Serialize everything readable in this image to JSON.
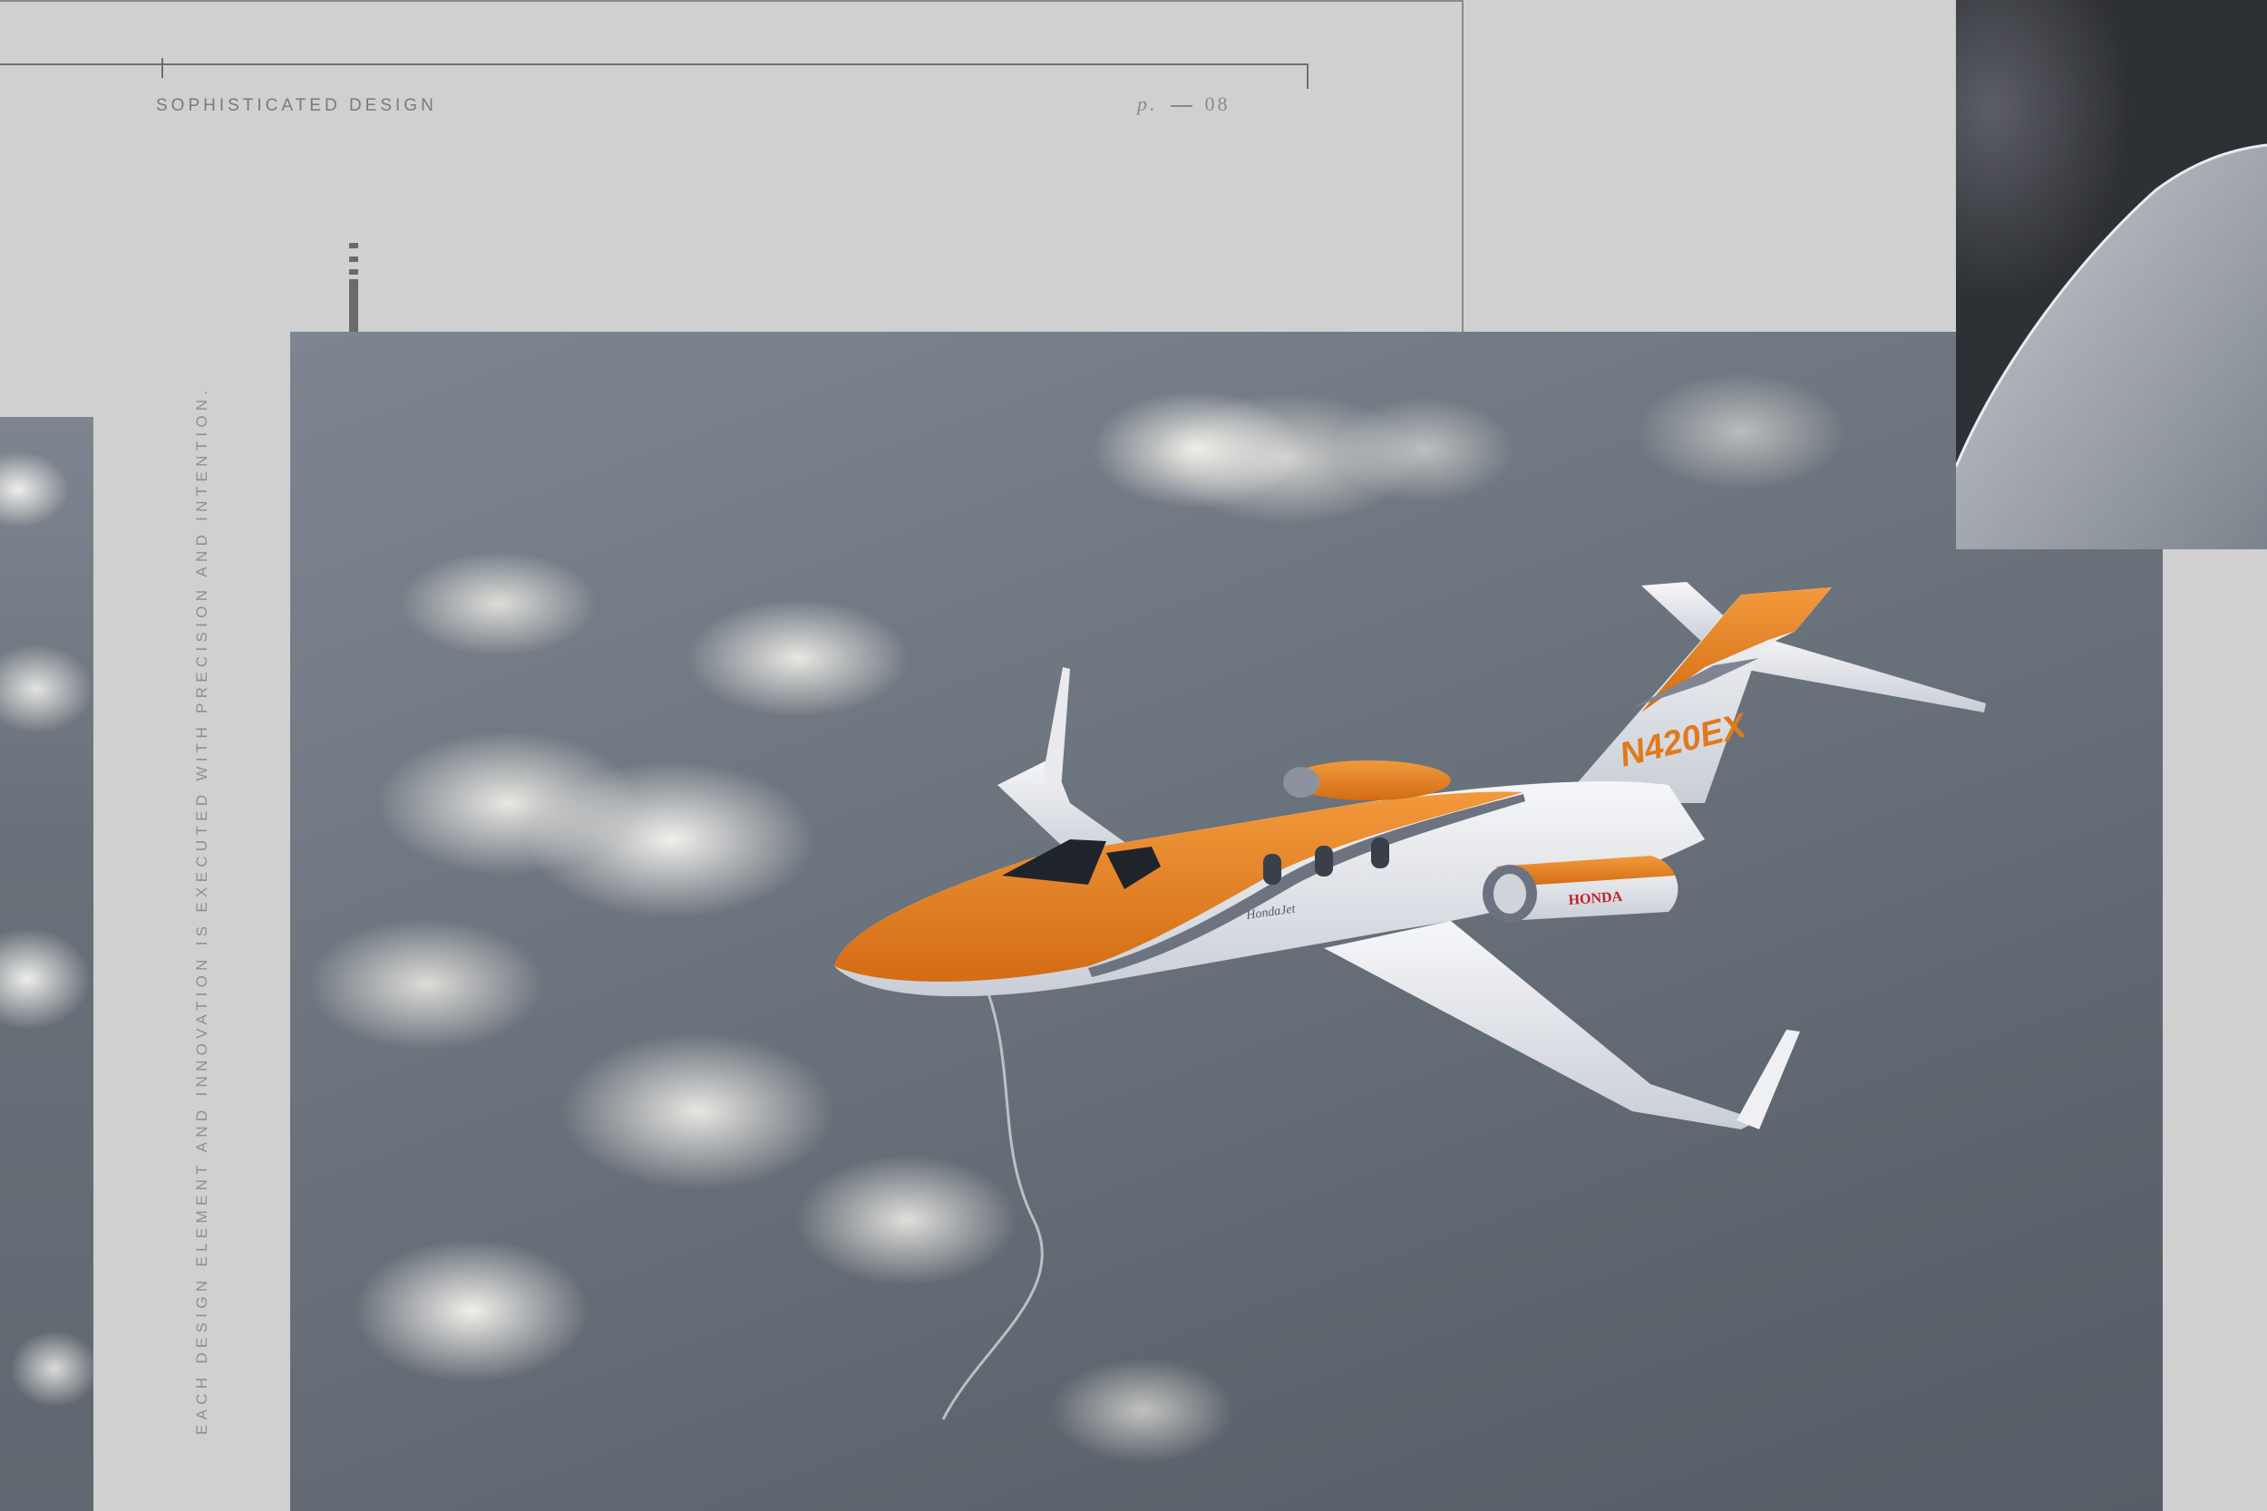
{
  "colors": {
    "page_background": "#d0d0d0",
    "accent_bar": "#6a6a6a",
    "jet_orange": "#e07a1c",
    "jet_white": "#eef0f3",
    "brand_red": "#c0222a"
  },
  "header": {
    "section_title": "SOPHISTICATED DESIGN",
    "page_prefix": "p.",
    "page_number": "08"
  },
  "caption": {
    "vertical_text": "EACH DESIGN ELEMENT AND INNOVATION IS EXECUTED WITH PRECISION AND INTENTION."
  },
  "photo": {
    "tail_registration": "N420EX",
    "engine_brand": "HONDA",
    "fuselage_script": "HondaJet"
  }
}
